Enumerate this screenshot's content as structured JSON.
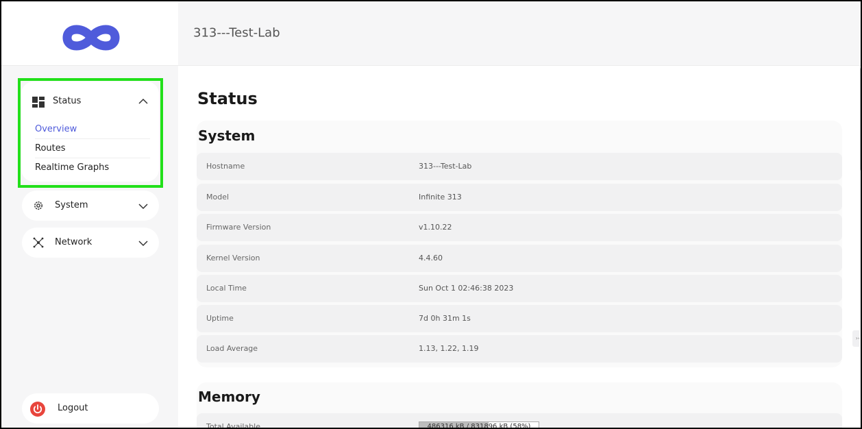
{
  "header": {
    "title": "313---Test-Lab"
  },
  "sidebar": {
    "status": {
      "label": "Status",
      "items": [
        {
          "label": "Overview",
          "active": true
        },
        {
          "label": "Routes",
          "active": false
        },
        {
          "label": "Realtime Graphs",
          "active": false
        }
      ]
    },
    "system": {
      "label": "System"
    },
    "network": {
      "label": "Network"
    },
    "logout": {
      "label": "Logout"
    }
  },
  "main": {
    "page_title": "Status",
    "system": {
      "title": "System",
      "rows": [
        {
          "key": "Hostname",
          "value": "313---Test-Lab"
        },
        {
          "key": "Model",
          "value": "Infinite 313"
        },
        {
          "key": "Firmware Version",
          "value": "v1.10.22"
        },
        {
          "key": "Kernel Version",
          "value": "4.4.60"
        },
        {
          "key": "Local Time",
          "value": "Sun Oct 1 02:46:38 2023"
        },
        {
          "key": "Uptime",
          "value": "7d 0h 31m 1s"
        },
        {
          "key": "Load Average",
          "value": "1.13, 1.22, 1.19"
        }
      ]
    },
    "memory": {
      "title": "Memory",
      "rows": [
        {
          "key": "Total Available",
          "value": "486316 kB / 831896 kB (58%)",
          "percent": 58
        }
      ]
    }
  },
  "colors": {
    "accent": "#4f5bdb",
    "highlight": "#22e01a",
    "logout": "#e8453c",
    "logo": "#4f5bdb"
  },
  "icons": {
    "logo": "infinity-logo",
    "status": "dashboard-icon",
    "system": "gear-icon",
    "network": "network-icon",
    "logout": "power-icon",
    "collapse": "chevron-up-icon",
    "expand": "chevron-down-icon"
  }
}
